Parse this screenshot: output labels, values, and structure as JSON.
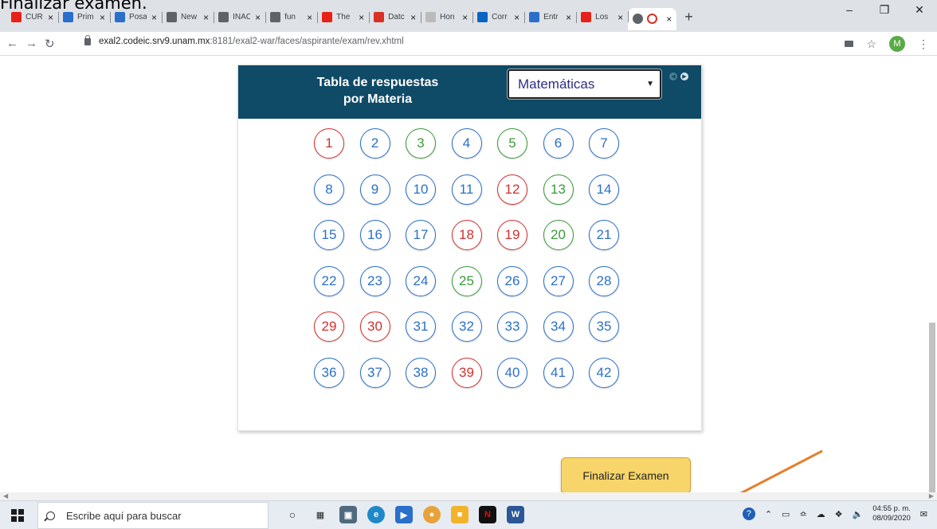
{
  "overlay_caption": "Finalizar examen.",
  "browser": {
    "tabs": [
      {
        "label": "CUR",
        "icon": "youtube-icon",
        "color": "#e62117"
      },
      {
        "label": "Prim",
        "icon": "play-icon",
        "color": "#2a6fc9"
      },
      {
        "label": "Posa",
        "icon": "meet-icon",
        "color": "#2a6fc9"
      },
      {
        "label": "New",
        "icon": "inac-icon",
        "color": "#5f6368"
      },
      {
        "label": "INAC",
        "icon": "inac-icon",
        "color": "#5f6368"
      },
      {
        "label": "fun",
        "icon": "inac-icon",
        "color": "#5f6368"
      },
      {
        "label": "The",
        "icon": "youtube-icon",
        "color": "#e62117"
      },
      {
        "label": "Datc",
        "icon": "gmail-icon",
        "color": "#d93025"
      },
      {
        "label": "Hon",
        "icon": "page-icon",
        "color": "#bbbbbb"
      },
      {
        "label": "Corr",
        "icon": "outlook-icon",
        "color": "#0a64c2"
      },
      {
        "label": "Entr",
        "icon": "meet-icon",
        "color": "#2a6fc9"
      },
      {
        "label": "Los",
        "icon": "youtube-icon",
        "color": "#e62117"
      }
    ],
    "url_host": "exal2.codeic.srv9.unam.mx",
    "url_rest": ":8181/exal2-war/faces/aspirante/exam/rev.xhtml",
    "avatar_letter": "M"
  },
  "card": {
    "title_line1": "Tabla de respuestas",
    "title_line2": "por Materia",
    "subject_selected": "Matemáticas"
  },
  "questions": [
    {
      "n": "1",
      "status": "wrong"
    },
    {
      "n": "2",
      "status": "neutral"
    },
    {
      "n": "3",
      "status": "right"
    },
    {
      "n": "4",
      "status": "neutral"
    },
    {
      "n": "5",
      "status": "right"
    },
    {
      "n": "6",
      "status": "neutral"
    },
    {
      "n": "7",
      "status": "neutral"
    },
    {
      "n": "8",
      "status": "neutral"
    },
    {
      "n": "9",
      "status": "neutral"
    },
    {
      "n": "10",
      "status": "neutral"
    },
    {
      "n": "11",
      "status": "neutral"
    },
    {
      "n": "12",
      "status": "wrong"
    },
    {
      "n": "13",
      "status": "right"
    },
    {
      "n": "14",
      "status": "neutral"
    },
    {
      "n": "15",
      "status": "neutral"
    },
    {
      "n": "16",
      "status": "neutral"
    },
    {
      "n": "17",
      "status": "neutral"
    },
    {
      "n": "18",
      "status": "wrong"
    },
    {
      "n": "19",
      "status": "wrong"
    },
    {
      "n": "20",
      "status": "right"
    },
    {
      "n": "21",
      "status": "neutral"
    },
    {
      "n": "22",
      "status": "neutral"
    },
    {
      "n": "23",
      "status": "neutral"
    },
    {
      "n": "24",
      "status": "neutral"
    },
    {
      "n": "25",
      "status": "right"
    },
    {
      "n": "26",
      "status": "neutral"
    },
    {
      "n": "27",
      "status": "neutral"
    },
    {
      "n": "28",
      "status": "neutral"
    },
    {
      "n": "29",
      "status": "wrong"
    },
    {
      "n": "30",
      "status": "wrong"
    },
    {
      "n": "31",
      "status": "neutral"
    },
    {
      "n": "32",
      "status": "neutral"
    },
    {
      "n": "33",
      "status": "neutral"
    },
    {
      "n": "34",
      "status": "neutral"
    },
    {
      "n": "35",
      "status": "neutral"
    },
    {
      "n": "36",
      "status": "neutral"
    },
    {
      "n": "37",
      "status": "neutral"
    },
    {
      "n": "38",
      "status": "neutral"
    },
    {
      "n": "39",
      "status": "wrong"
    },
    {
      "n": "40",
      "status": "neutral"
    },
    {
      "n": "41",
      "status": "neutral"
    },
    {
      "n": "42",
      "status": "neutral"
    }
  ],
  "finish_button_label": "Finalizar Examen",
  "annotation_arrow_color": "#e87d2a",
  "colors": {
    "header": "#0f4a66",
    "neutral": "#2a6fc9",
    "wrong": "#d3302f",
    "right": "#3a9a3a",
    "button": "#f8d56a"
  },
  "taskbar": {
    "search_placeholder": "Escribe aquí para buscar",
    "time": "04:55 p. m.",
    "date": "08/09/2020"
  }
}
